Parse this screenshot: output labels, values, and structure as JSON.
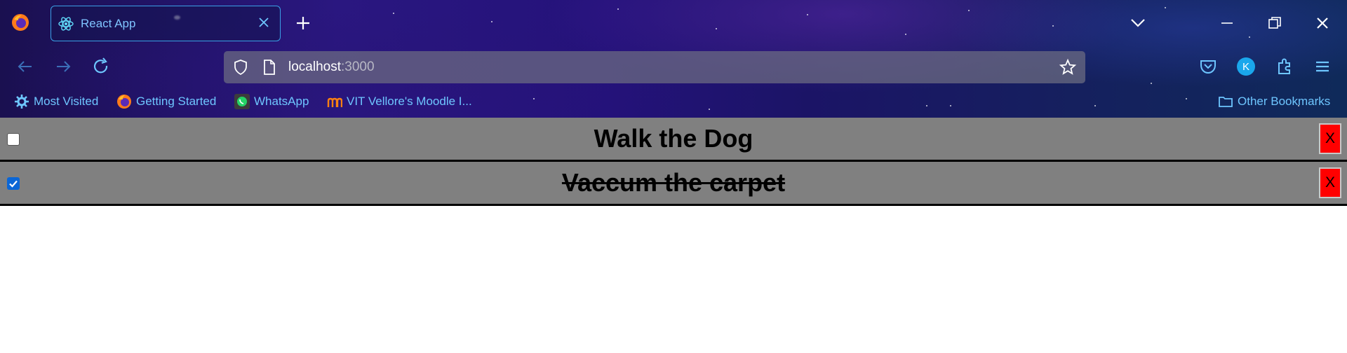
{
  "browser": {
    "tab_title": "React App",
    "url_host": "localhost",
    "url_port": ":3000",
    "bookmarks": [
      {
        "label": "Most Visited",
        "icon": "gear-icon"
      },
      {
        "label": "Getting Started",
        "icon": "firefox-icon"
      },
      {
        "label": "WhatsApp",
        "icon": "whatsapp-icon"
      },
      {
        "label": "VIT Vellore's Moodle I...",
        "icon": "moodle-icon"
      }
    ],
    "other_bookmarks": "Other Bookmarks",
    "profile_initial": "K",
    "colors": {
      "tab_border": "#3aa0e6",
      "link": "#6ec6ff"
    }
  },
  "todos": [
    {
      "text": "Walk the Dog",
      "completed": false,
      "delete_label": "X"
    },
    {
      "text": "Vaccum the carpet",
      "completed": true,
      "delete_label": "X"
    }
  ],
  "colors": {
    "row_background": "#808080",
    "delete_button": "#ff0000",
    "checkbox_checked": "#0a66d6"
  }
}
